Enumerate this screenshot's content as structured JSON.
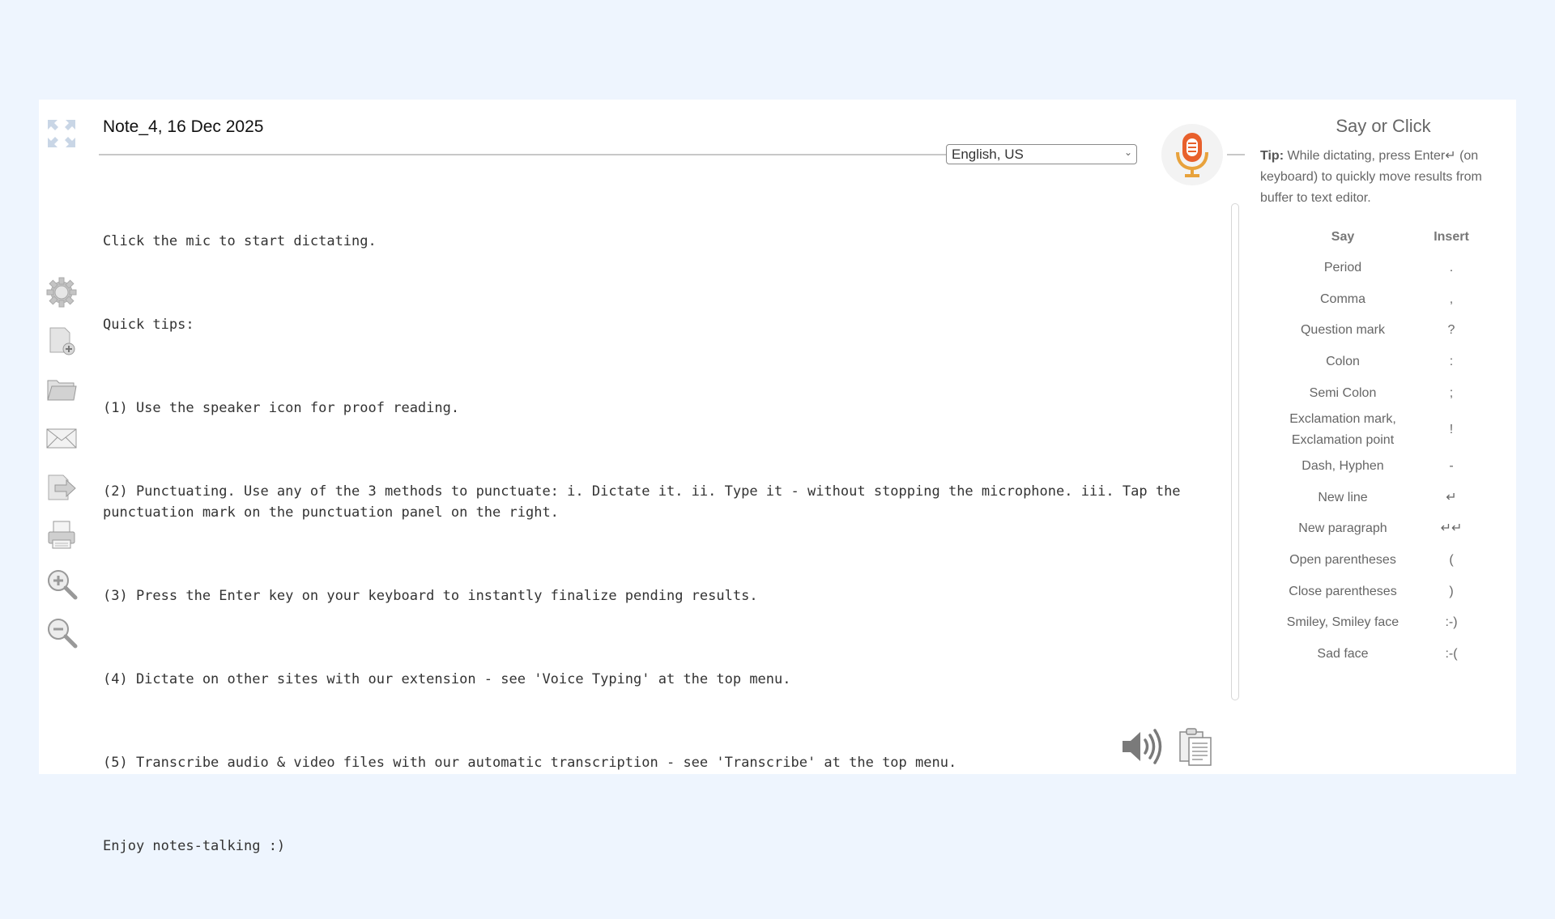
{
  "note": {
    "title": "Note_4, 16 Dec 2025"
  },
  "language": {
    "selected": "English, US"
  },
  "editor": {
    "lines": [
      "Click the mic to start dictating.",
      "Quick tips:",
      "(1) Use the speaker icon for proof reading.",
      "(2) Punctuating. Use any of the 3 methods to punctuate: i. Dictate it. ii. Type it - without stopping the microphone. iii. Tap the punctuation mark on the punctuation panel on the right.",
      "(3) Press the Enter key on your keyboard to instantly finalize pending results.",
      "(4) Dictate on other sites with our extension - see 'Voice Typing' at the top menu.",
      "(5) Transcribe audio & video files with our automatic transcription - see 'Transcribe' at the top menu.",
      "Enjoy notes-talking :)"
    ]
  },
  "panel": {
    "title": "Say or Click",
    "tip_label": "Tip:",
    "tip_text": " While dictating, press Enter↵ (on keyboard) to quickly move results from buffer to text editor.",
    "col_say": "Say",
    "col_insert": "Insert",
    "rows": [
      {
        "say": "Period",
        "insert": "."
      },
      {
        "say": "Comma",
        "insert": ","
      },
      {
        "say": "Question mark",
        "insert": "?"
      },
      {
        "say": "Colon",
        "insert": ":"
      },
      {
        "say": "Semi Colon",
        "insert": ";"
      },
      {
        "say": "Exclamation mark, Exclamation point",
        "insert": "!"
      },
      {
        "say": "Dash, Hyphen",
        "insert": "-"
      },
      {
        "say": "New line",
        "insert": "↵"
      },
      {
        "say": "New paragraph",
        "insert": "↵↵"
      },
      {
        "say": "Open parentheses",
        "insert": "("
      },
      {
        "say": "Close parentheses",
        "insert": ")"
      },
      {
        "say": "Smiley, Smiley face",
        "insert": ":-)"
      },
      {
        "say": "Sad face",
        "insert": ":-("
      }
    ]
  },
  "colors": {
    "background": "#eef5fe",
    "mic_accent": "#e8602c",
    "icon_gray": "#9a9a9a"
  },
  "icons": {
    "toolbar": [
      "expand-icon",
      "gear-icon",
      "new-note-icon",
      "folder-icon",
      "email-icon",
      "export-icon",
      "print-icon",
      "zoom-in-icon",
      "zoom-out-icon"
    ],
    "mic": "microphone-icon",
    "speaker": "speaker-icon",
    "copy": "copy-icon"
  }
}
